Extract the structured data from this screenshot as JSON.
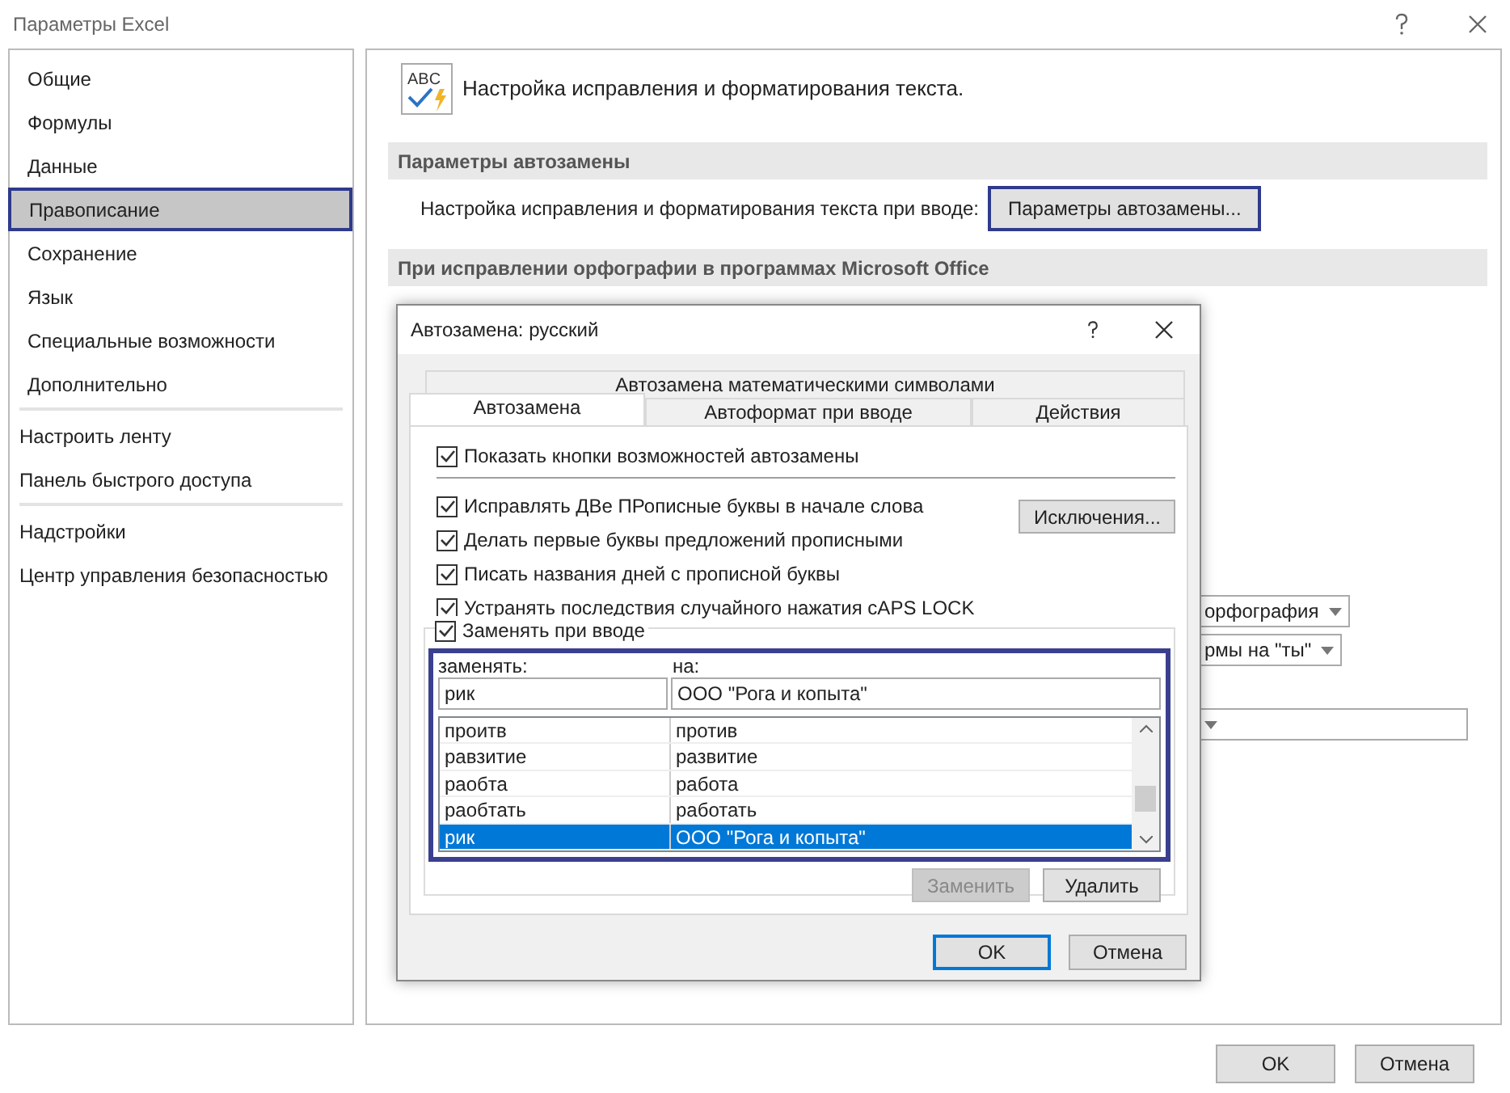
{
  "window": {
    "title": "Параметры Excel"
  },
  "sidebar": {
    "groups": [
      [
        {
          "label": "Общие",
          "selected": false,
          "outlined": false
        },
        {
          "label": "Формулы",
          "selected": false,
          "outlined": false
        },
        {
          "label": "Данные",
          "selected": false,
          "outlined": false
        },
        {
          "label": "Правописание",
          "selected": true,
          "outlined": true
        },
        {
          "label": "Сохранение",
          "selected": false,
          "outlined": false
        },
        {
          "label": "Язык",
          "selected": false,
          "outlined": false
        },
        {
          "label": "Специальные возможности",
          "selected": false,
          "outlined": false
        },
        {
          "label": "Дополнительно",
          "selected": false,
          "outlined": false
        }
      ],
      [
        {
          "label": "Настроить ленту",
          "selected": false,
          "outlined": false
        },
        {
          "label": "Панель быстрого доступа",
          "selected": false,
          "outlined": false
        }
      ],
      [
        {
          "label": "Надстройки",
          "selected": false,
          "outlined": false
        },
        {
          "label": "Центр управления безопасностью",
          "selected": false,
          "outlined": false
        }
      ]
    ]
  },
  "content": {
    "icon_text": "ABC",
    "intro": "Настройка исправления и форматирования текста.",
    "autocorrect_section": {
      "title": "Параметры автозамены",
      "label": "Настройка исправления и форматирования текста при вводе:",
      "button": {
        "label": "Параметры автозамены...",
        "outlined": true
      }
    },
    "office_section": {
      "title": "При исправлении орфографии в программах Microsoft Office"
    },
    "dropdowns": [
      {
        "kind": "filled",
        "value": "орфография"
      },
      {
        "kind": "filled",
        "value": "рмы на \"ты\""
      },
      {
        "kind": "blank"
      }
    ]
  },
  "footer": {
    "buttons": [
      "OK",
      "Отмена"
    ]
  },
  "dialog": {
    "title": "Автозамена: русский",
    "tabs_top": [
      {
        "label": "Автозамена математическими символами",
        "selected": false
      }
    ],
    "tabs": [
      {
        "label": "Автозамена",
        "selected": true
      },
      {
        "label": "Автоформат при вводе",
        "selected": false
      },
      {
        "label": "Действия",
        "selected": false
      }
    ],
    "show_buttons": {
      "label": "Показать кнопки возможностей автозамены",
      "checked": true
    },
    "options": [
      {
        "label": "Исправлять ДВе ПРописные буквы в начале слова",
        "checked": true
      },
      {
        "label": "Делать первые буквы предложений прописными",
        "checked": true
      },
      {
        "label": "Писать названия дней с прописной буквы",
        "checked": true
      },
      {
        "label": "Устранять последствия случайного нажатия cAPS LOCK",
        "checked": true
      }
    ],
    "exceptions_button": "Исключения...",
    "replace_group": {
      "label": "Заменять при вводе",
      "checked": true,
      "outlined": true,
      "replace_label": "заменять:",
      "with_label": "на:",
      "replace_value": "рик",
      "with_value": "ООО \"Рога и копыта\"",
      "rows": [
        {
          "from": "проитв",
          "to": "против",
          "selected": false
        },
        {
          "from": "равзитие",
          "to": "развитие",
          "selected": false
        },
        {
          "from": "раобта",
          "to": "работа",
          "selected": false
        },
        {
          "from": "раобтать",
          "to": "работать",
          "selected": false
        },
        {
          "from": "рик",
          "to": "ООО \"Рога и копыта\"",
          "selected": true
        }
      ],
      "buttons": [
        {
          "label": "Заменить",
          "disabled": true
        },
        {
          "label": "Удалить",
          "disabled": false
        }
      ]
    },
    "buttons": [
      {
        "label": "OK",
        "focused": true
      },
      {
        "label": "Отмена",
        "focused": false
      }
    ]
  }
}
